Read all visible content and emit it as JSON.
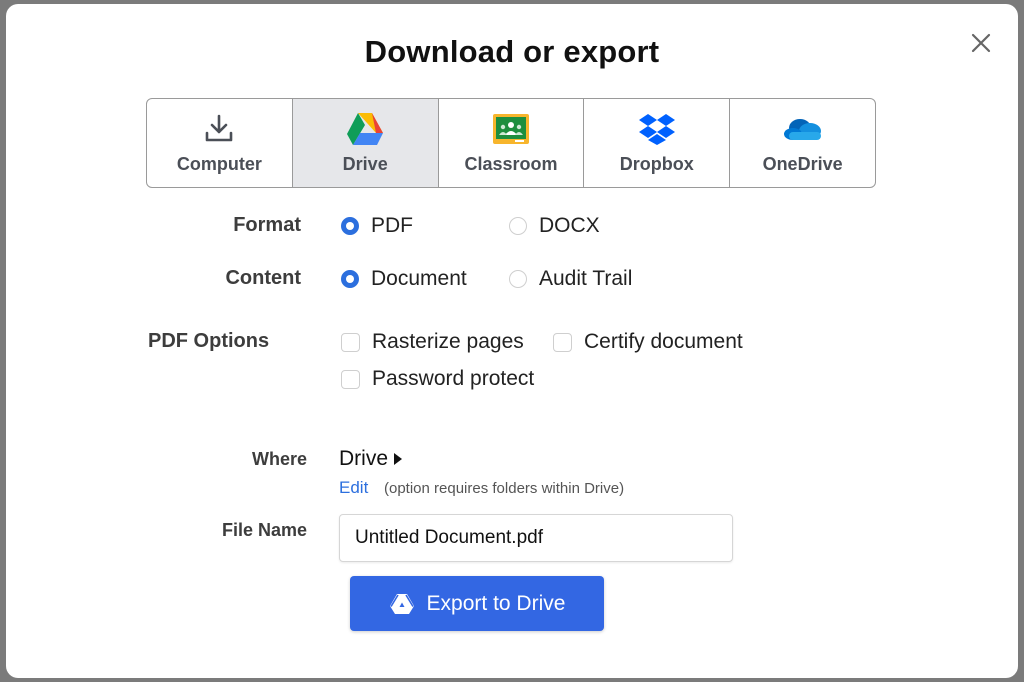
{
  "dialog": {
    "title": "Download or export",
    "close_icon": "close-icon"
  },
  "tabs": [
    {
      "label": "Computer",
      "icon": "download-icon",
      "active": false
    },
    {
      "label": "Drive",
      "icon": "google-drive-icon",
      "active": true
    },
    {
      "label": "Classroom",
      "icon": "google-classroom-icon",
      "active": false
    },
    {
      "label": "Dropbox",
      "icon": "dropbox-icon",
      "active": false
    },
    {
      "label": "OneDrive",
      "icon": "onedrive-icon",
      "active": false
    }
  ],
  "format": {
    "label": "Format",
    "options": [
      {
        "label": "PDF",
        "selected": true
      },
      {
        "label": "DOCX",
        "selected": false
      }
    ]
  },
  "content": {
    "label": "Content",
    "options": [
      {
        "label": "Document",
        "selected": true
      },
      {
        "label": "Audit Trail",
        "selected": false
      }
    ]
  },
  "pdf_options": {
    "label": "PDF Options",
    "options": [
      {
        "label": "Rasterize pages",
        "checked": false
      },
      {
        "label": "Certify document",
        "checked": false
      },
      {
        "label": "Password protect",
        "checked": false
      }
    ]
  },
  "where": {
    "label": "Where",
    "value": "Drive",
    "edit_label": "Edit",
    "note": "(option requires folders within Drive)"
  },
  "file_name": {
    "label": "File Name",
    "value": "Untitled Document.pdf"
  },
  "export_button": {
    "label": "Export to Drive",
    "icon": "google-drive-icon"
  },
  "colors": {
    "accent": "#3367e3",
    "radio_on": "#2c6fde",
    "active_tab_bg": "#e6e7ea"
  }
}
